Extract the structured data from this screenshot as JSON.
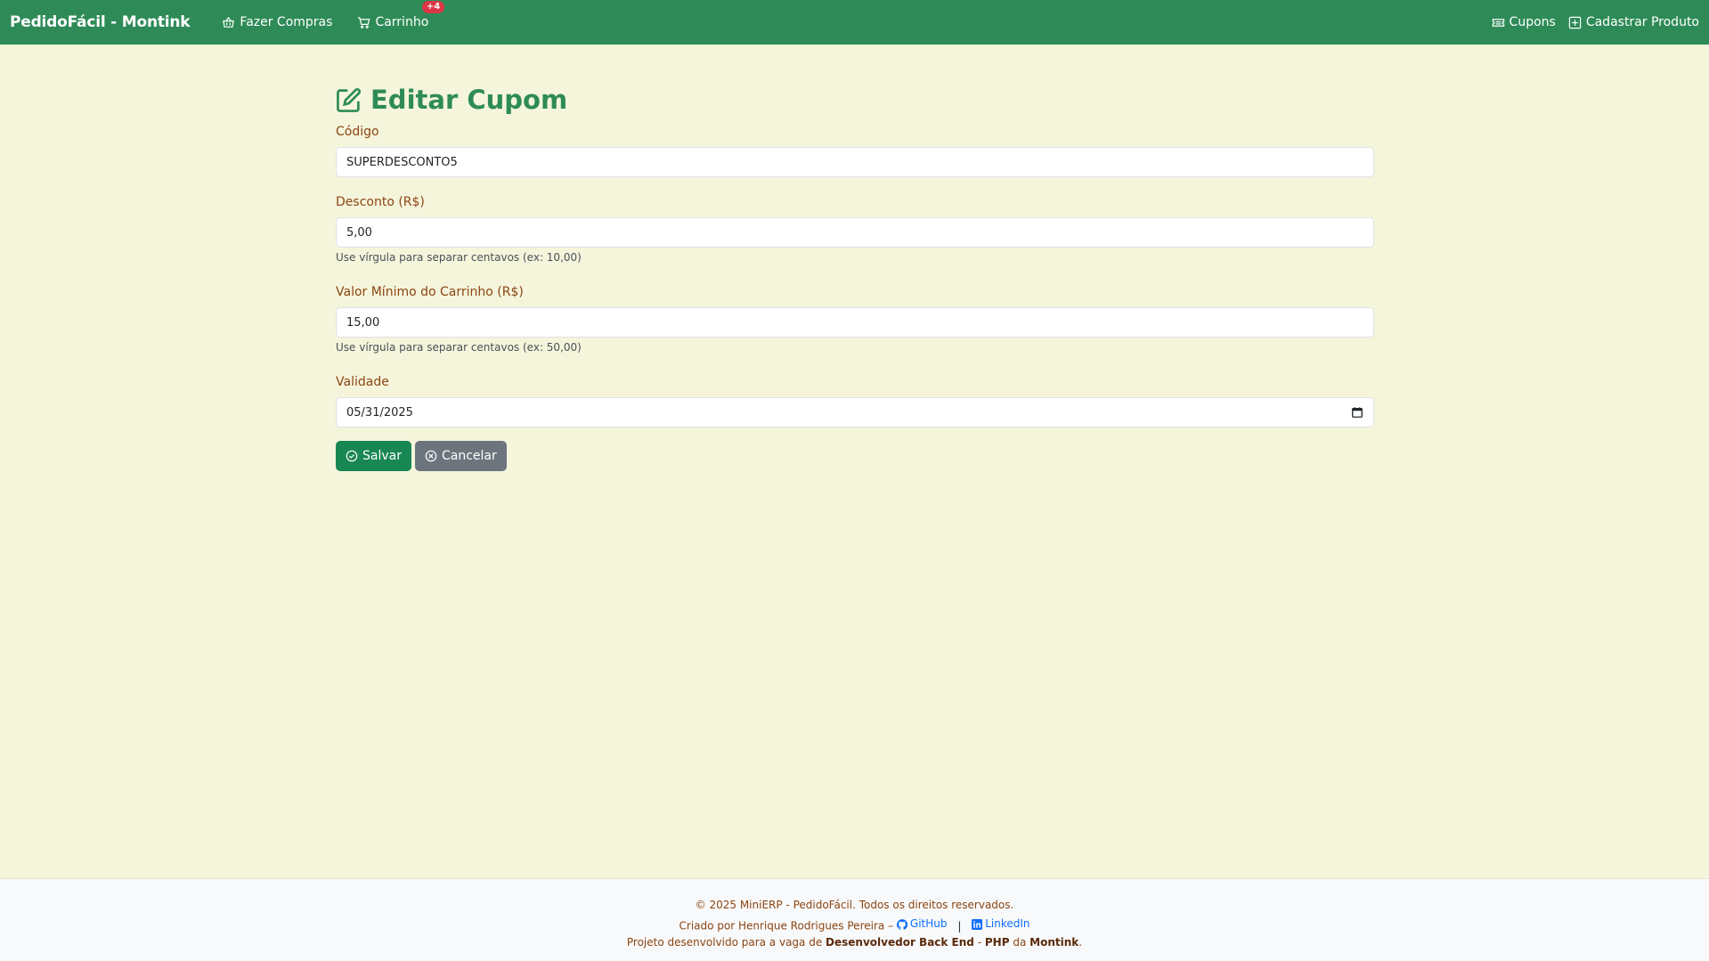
{
  "navbar": {
    "brand": "PedidoFácil - Montink",
    "links": {
      "shop": "Fazer Compras",
      "cart": "Carrinho",
      "cart_badge": "+4",
      "coupons": "Cupons",
      "add_product": "Cadastrar Produto"
    }
  },
  "page": {
    "title": "Editar Cupom"
  },
  "form": {
    "code": {
      "label": "Código",
      "value": "SUPERDESCONTO5"
    },
    "discount": {
      "label": "Desconto (R$)",
      "value": "5,00",
      "help": "Use vírgula para separar centavos (ex: 10,00)"
    },
    "min_cart": {
      "label": "Valor Mínimo do Carrinho (R$)",
      "value": "15,00",
      "help": "Use vírgula para separar centavos (ex: 50,00)"
    },
    "validity": {
      "label": "Validade",
      "value": "05/31/2025"
    },
    "save_label": "Salvar",
    "cancel_label": "Cancelar"
  },
  "footer": {
    "copyright": "© 2025 MiniERP - PedidoFácil. Todos os direitos reservados.",
    "created_by": "Criado por Henrique Rodrigues Pereira –",
    "github": "GitHub",
    "separator": "|",
    "linkedin": "LinkedIn",
    "project_prefix": "Projeto desenvolvido para a vaga de",
    "role": "Desenvolvedor Back End",
    "dash": "-",
    "tech": "PHP",
    "da": "da",
    "company": "Montink",
    "period": "."
  },
  "colors": {
    "navbar": "#2e8b57",
    "background": "#f5f5dc",
    "label": "#8b4513",
    "save": "#198754",
    "cancel": "#6c757d",
    "badge": "#dc3545"
  }
}
